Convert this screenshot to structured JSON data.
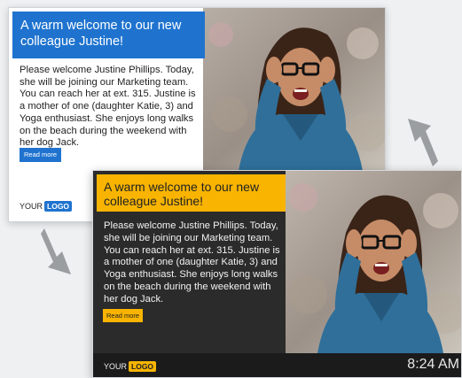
{
  "light_card": {
    "title": "A warm welcome to our new colleague Justine!",
    "body": "Please welcome Justine Phillips. Today, she will be joining our Marketing team. You can reach her at ext. 315. Justine is a mother of one (daughter Katie, 3) and Yoga enthusiast. She enjoys long walks on the beach during the weekend with her dog Jack.",
    "read_more": "Read more",
    "footer_your": "YOUR",
    "footer_logo": "LOGO",
    "accent": "#1f73cf"
  },
  "dark_card": {
    "title": "A warm welcome to our new colleague Justine!",
    "body": "Please welcome Justine Phillips. Today, she will be joining our Marketing team. You can reach her at ext. 315. Justine is a mother of one (daughter Katie, 3) and Yoga enthusiast. She enjoys long walks on the beach during the weekend with her dog Jack.",
    "read_more": "Read more",
    "footer_your": "YOUR",
    "footer_logo": "LOGO",
    "clock": "8:24 AM",
    "accent": "#f8b400"
  },
  "icons": {
    "arrow_up": "arrow-up-left-icon",
    "arrow_down": "arrow-down-right-icon"
  }
}
